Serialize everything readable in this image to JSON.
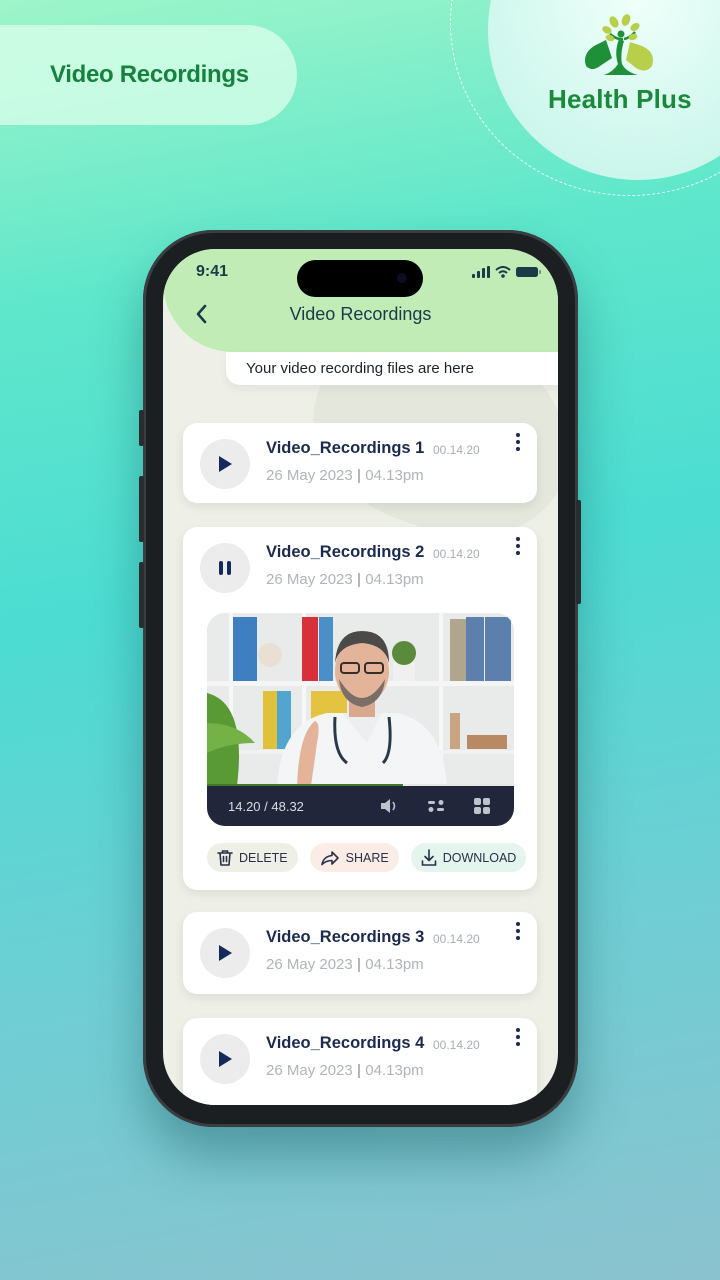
{
  "promo": {
    "title": "Video Recordings",
    "brand_name": "Health Plus"
  },
  "status_bar": {
    "time": "9:41",
    "icons": [
      "signal-icon",
      "wifi-icon",
      "battery-icon"
    ]
  },
  "header": {
    "back_icon": "chevron-left-icon",
    "title": "Video Recordings",
    "subtitle": "Your video recording files are here"
  },
  "recordings": [
    {
      "name": "Video_Recordings 1",
      "duration": "00.14.20",
      "date": "26 May 2023",
      "time": "04.13pm",
      "state": "paused-collapsed",
      "control_icon": "play-icon"
    },
    {
      "name": "Video_Recordings 2",
      "duration": "00.14.20",
      "date": "26 May 2023",
      "time": "04.13pm",
      "state": "playing-expanded",
      "control_icon": "pause-icon",
      "player": {
        "time_display": "14.20 / 48.32",
        "progress": 0.64,
        "icons": [
          "volume-icon",
          "settings-sliders-icon",
          "grid-icon"
        ]
      },
      "actions": [
        {
          "label": "DELETE",
          "icon": "trash-icon",
          "bg": "#eef0e8"
        },
        {
          "label": "SHARE",
          "icon": "share-arrow-icon",
          "bg": "#fbede6"
        },
        {
          "label": "DOWNLOAD",
          "icon": "download-icon",
          "bg": "#e4f5ee"
        }
      ]
    },
    {
      "name": "Video_Recordings 3",
      "duration": "00.14.20",
      "date": "26 May 2023",
      "time": "04.13pm",
      "state": "paused-collapsed",
      "control_icon": "play-icon"
    },
    {
      "name": "Video_Recordings 4",
      "duration": "00.14.20",
      "date": "26 May 2023",
      "time": "04.13pm",
      "state": "paused-collapsed",
      "control_icon": "play-icon"
    }
  ],
  "colors": {
    "brand_green": "#1a8a3a",
    "header_green": "#c1ecb6",
    "navy_text": "#1b2a4e",
    "muted_text": "#b0b3b8"
  }
}
